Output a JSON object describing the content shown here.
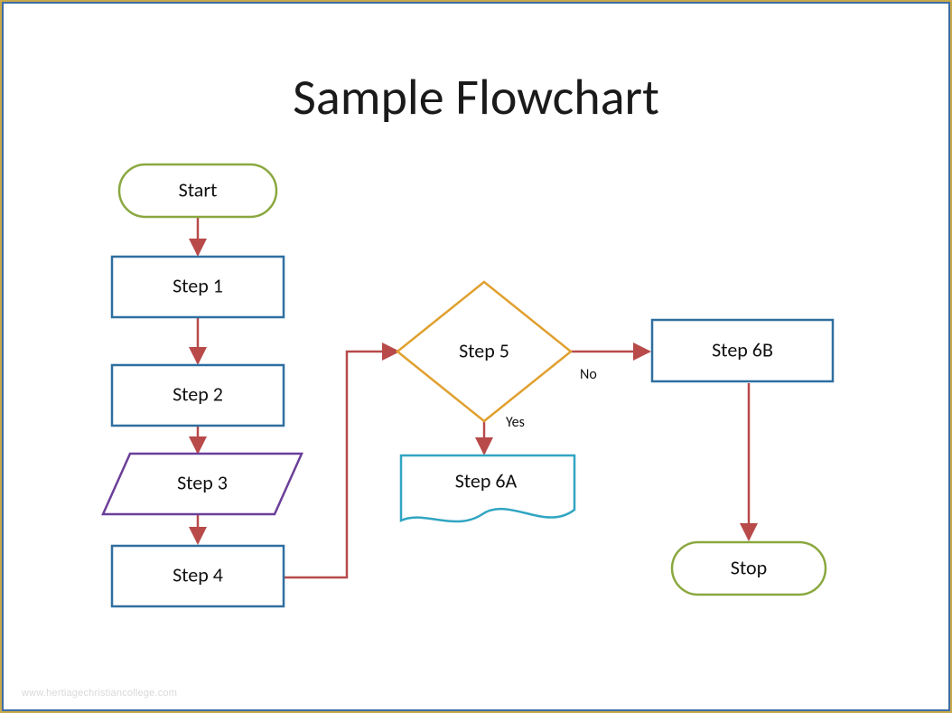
{
  "title": "Sample Flowchart",
  "nodes": {
    "start": "Start",
    "step1": "Step 1",
    "step2": "Step 2",
    "step3": "Step 3",
    "step4": "Step 4",
    "step5": "Step 5",
    "step6a": "Step 6A",
    "step6b": "Step 6B",
    "stop": "Stop"
  },
  "labels": {
    "no": "No",
    "yes": "Yes"
  },
  "watermark": "www.hertiagechristiancollege.com",
  "chart_data": {
    "type": "flowchart",
    "title": "Sample Flowchart",
    "nodes": [
      {
        "id": "start",
        "shape": "terminator",
        "label": "Start"
      },
      {
        "id": "step1",
        "shape": "process",
        "label": "Step 1"
      },
      {
        "id": "step2",
        "shape": "process",
        "label": "Step 2"
      },
      {
        "id": "step3",
        "shape": "parallelogram",
        "label": "Step 3"
      },
      {
        "id": "step4",
        "shape": "process",
        "label": "Step 4"
      },
      {
        "id": "step5",
        "shape": "decision",
        "label": "Step 5"
      },
      {
        "id": "step6a",
        "shape": "document",
        "label": "Step 6A"
      },
      {
        "id": "step6b",
        "shape": "process",
        "label": "Step 6B"
      },
      {
        "id": "stop",
        "shape": "terminator",
        "label": "Stop"
      }
    ],
    "edges": [
      {
        "from": "start",
        "to": "step1"
      },
      {
        "from": "step1",
        "to": "step2"
      },
      {
        "from": "step2",
        "to": "step3"
      },
      {
        "from": "step3",
        "to": "step4"
      },
      {
        "from": "step4",
        "to": "step5"
      },
      {
        "from": "step5",
        "to": "step6b",
        "label": "No"
      },
      {
        "from": "step5",
        "to": "step6a",
        "label": "Yes"
      },
      {
        "from": "step6b",
        "to": "stop"
      }
    ]
  }
}
